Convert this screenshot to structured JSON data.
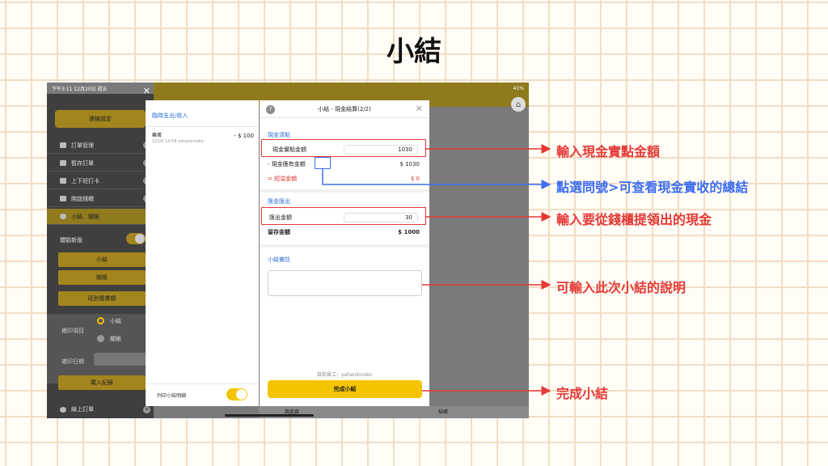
{
  "page_title": "小結",
  "device": {
    "status_time": "下午3:11  12月20日 週五",
    "status_battery": "41%"
  },
  "sidebar": {
    "close_icon": "✕",
    "top_button": "連線設定",
    "items": [
      {
        "label": "訂單管理"
      },
      {
        "label": "暫存訂單"
      },
      {
        "label": "上下班打卡"
      },
      {
        "label": "開啟錢櫃"
      },
      {
        "label": "小結．關帳"
      }
    ],
    "toggle_label": "體驗新版",
    "btn_xiaojie": "小結",
    "btn_guanzhang": "關帳",
    "btn_revenue": "班別營業額",
    "reprint_label": "補印項目",
    "radio_xiaojie": "小結",
    "radio_guanzhang": "關帳",
    "reprint_date_label": "補印日期",
    "load_btn": "載入紀錄",
    "online_orders": "線上訂單"
  },
  "left_panel": {
    "header": "臨時支出/收入",
    "item_name": "雞蛋",
    "item_meta": "12/20 14:58 yahankinoko",
    "item_amount": "- $ 100",
    "print_label": "列印小結明細"
  },
  "modal": {
    "title": "小結 - 現金結算(2/2)",
    "section_count": "現金清點",
    "actual_cash_label": "現金實點金額",
    "actual_cash_value": "1030",
    "expected_label": "- 現金應有金額",
    "expected_value": "$ 1030",
    "shortage_label": "= 短溢金額",
    "shortage_value": "$ 0",
    "section_payout": "匯金匯出",
    "payout_label": "匯出金額",
    "payout_value": "30",
    "retained_label": "留存金額",
    "retained_value": "$ 1000",
    "section_note": "小結備註",
    "staff": "目前員工：yahankinoko",
    "done_button": "完成小結"
  },
  "bottom_tabs": {
    "tab1": "商品頁",
    "tab2": "結帳"
  },
  "annotations": {
    "a1": "輸入現金實點金額",
    "a2": "點選問號>可查看現金實收的總結",
    "a3": "輸入要從錢櫃提領出的現金",
    "a4": "可輸入此次小結的說明",
    "a5": "完成小結"
  },
  "colors": {
    "accent_yellow": "#f5c400",
    "annotation_red": "#e53935",
    "annotation_blue": "#3d6df2",
    "section_blue": "#2f6fd6"
  }
}
